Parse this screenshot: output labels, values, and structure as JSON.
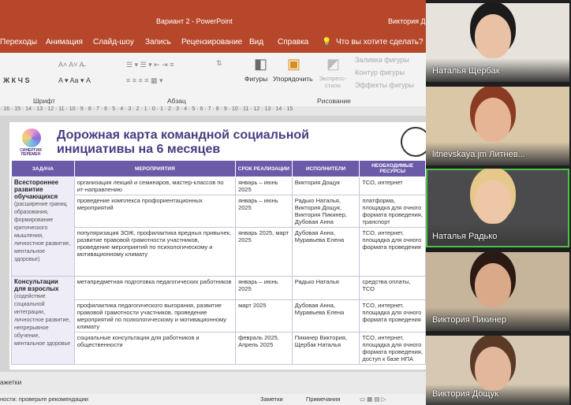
{
  "window": {
    "title": "Вариант 2 - PowerPoint",
    "user": "Виктория До"
  },
  "menu": [
    "Переходы",
    "Анимация",
    "Слайд-шоу",
    "Запись",
    "Рецензирование",
    "Вид",
    "Справка"
  ],
  "menu_search": "Что вы хотите сделать?",
  "ribbon": {
    "groups": [
      "Шрифт",
      "Абзац",
      "Рисование"
    ],
    "shapes": "Фигуры",
    "arrange": "Упорядочить",
    "quick_styles": "Экспресс-стили",
    "fill": "Заливка фигуры",
    "outline": "Контур фигуры",
    "effects": "Эффекты фигуры"
  },
  "ruler": "· 16 · 15 · 14 · 13 · 12 · 11 · 10 · 9 · 8 · 7 · 6 · 5 · 4 · 3 · 2 · 1 · 0 · 1 · 2 · 3 · 4 · 5 · 6 · 7 · 8 · 9 · 10 · 11 · 12 · 13 · 14 · 15",
  "slide": {
    "logo_text": "СИНЕРГИЯ ПЕРЕМЕН",
    "title": "Дорожная карта командной социальной инициативы на 6 месяцев",
    "headers": [
      "ЗАДАЧА",
      "МЕРОПРИЯТИЯ",
      "СРОК РЕАЛИЗАЦИИ",
      "ИСПОЛНИТЕЛИ",
      "НЕОБХОДИМЫЕ РЕСУРСЫ"
    ],
    "tasks": [
      {
        "title": "Всестороннее развитие обучающихся",
        "desc": "(расширение границ образования, формирование критического мышления, личностное развитие, ментальное здоровье)"
      },
      {
        "title": "Консультации для взрослых",
        "desc": "(содействие социальной интеграции, личностное развитие, непрерывное обучение, ментальное здоровье"
      }
    ],
    "rows": [
      {
        "event": "организация лекций и семинаров, мастер-классов по ит-направлению",
        "term": "январь – июнь 2025",
        "who": "Виктория Дощук",
        "res": "ТСО, интернет"
      },
      {
        "event": "проведение комплекса профориентационных мероприятий",
        "term": "январь – июнь 2025",
        "who": "Радько Наталья, Виктория Дощук, Виктория Пикинер, Дубовая Анна",
        "res": "платформа, площадка для очного формата проведения, транспорт"
      },
      {
        "event": "популяризация ЗОЖ, профилактика вредных привычек, развитие правовой грамотности участников, проведение мероприятий по психологическому и мотивационному климату",
        "term": "январь 2025, март 2025",
        "who": "Дубовая Анна, Муравьева Елена",
        "res": "ТСО, интернет, площадка для очного формата проведения"
      },
      {
        "event": "метапредметная подготовка педагогических работников",
        "term": "январь – июнь 2025",
        "who": "Радько Наталья",
        "res": "средства оплаты, ТСО"
      },
      {
        "event": "профилактика педагогического выгорания, развитие правовой грамотности участников, проведение мероприятий по психологическому и мотивационному климату",
        "term": "март 2025",
        "who": "Дубовая Анна, Муравьева Елена",
        "res": "ТСО, интернет, площадка для очного формата проведения"
      },
      {
        "event": "социальные консультации для работников и общественности",
        "term": "февраль 2025, Апрель 2025",
        "who": "Пикинер Виктория, Щербак Наталья",
        "res": "ТСО, интернет, площадка для очного формата проведения, доступ к базе НПА"
      }
    ]
  },
  "status": {
    "notes_label": "ажетки",
    "accessibility": "ности: проверьте рекомендации",
    "notes": "Заметки",
    "comments": "Примечания"
  },
  "participants": [
    {
      "name": "Наталья Щербак",
      "bg": "#e8e2dc",
      "skin": "#e9c2a6",
      "hair": "#1b1b1b"
    },
    {
      "name": "litnevskaya.jm Литнев...",
      "bg": "#d9c7a8",
      "skin": "#e6b596",
      "hair": "#8a3b22"
    },
    {
      "name": "Наталья Радько",
      "bg": "#4b4a4c",
      "skin": "#eec6a8",
      "hair": "#e6c98a"
    },
    {
      "name": "Виктория Пикинер",
      "bg": "#c6b59b",
      "skin": "#d9a98a",
      "hair": "#2b1a14"
    },
    {
      "name": "Виктория Дощук",
      "bg": "#d6c8b3",
      "skin": "#e2b79b",
      "hair": "#5a3a26"
    }
  ]
}
